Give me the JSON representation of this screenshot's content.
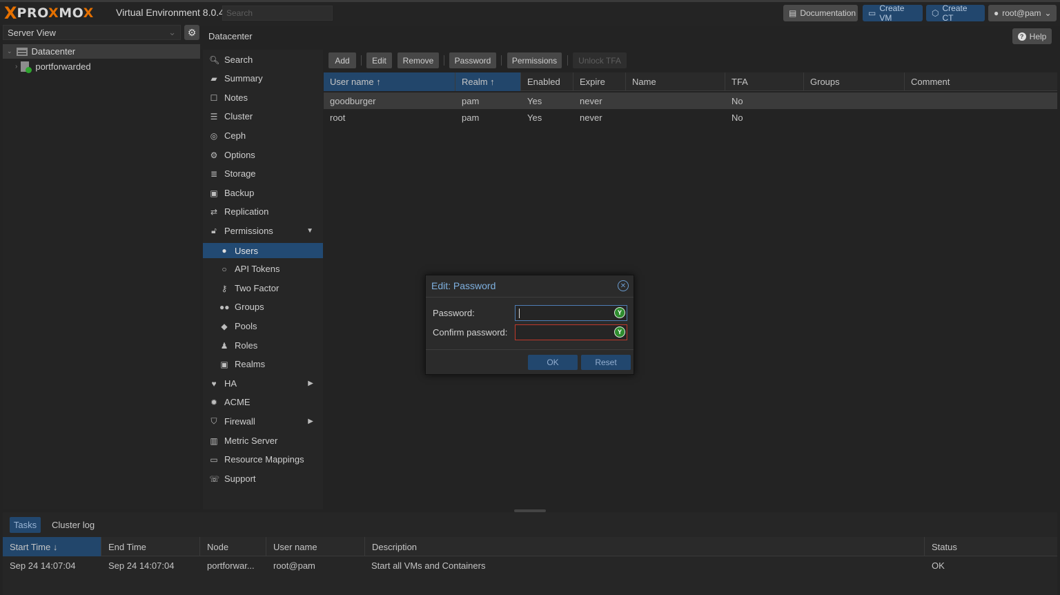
{
  "topbar": {
    "logo_x": "X",
    "logo_word_a": "PRO",
    "logo_word_o": "X",
    "logo_word_b": "MO",
    "logo_word_x": "X",
    "version": "Virtual Environment 8.0.4",
    "search_placeholder": "Search",
    "documentation": "Documentation",
    "create_vm": "Create VM",
    "create_ct": "Create CT",
    "user": "root@pam"
  },
  "tree": {
    "view_label": "Server View",
    "datacenter": "Datacenter",
    "node": "portforwarded"
  },
  "header": {
    "title": "Datacenter",
    "help": "Help"
  },
  "nav": {
    "search": "Search",
    "summary": "Summary",
    "notes": "Notes",
    "cluster": "Cluster",
    "ceph": "Ceph",
    "options": "Options",
    "storage": "Storage",
    "backup": "Backup",
    "replication": "Replication",
    "permissions": "Permissions",
    "users": "Users",
    "api_tokens": "API Tokens",
    "two_factor": "Two Factor",
    "groups": "Groups",
    "pools": "Pools",
    "roles": "Roles",
    "realms": "Realms",
    "ha": "HA",
    "acme": "ACME",
    "firewall": "Firewall",
    "metric_server": "Metric Server",
    "resource_mappings": "Resource Mappings",
    "support": "Support"
  },
  "toolbar": {
    "add": "Add",
    "edit": "Edit",
    "remove": "Remove",
    "password": "Password",
    "permissions": "Permissions",
    "unlock_tfa": "Unlock TFA"
  },
  "grid": {
    "columns": {
      "username": "User name ↑",
      "realm": "Realm ↑",
      "enabled": "Enabled",
      "expire": "Expire",
      "name": "Name",
      "tfa": "TFA",
      "groups": "Groups",
      "comment": "Comment"
    },
    "rows": [
      {
        "username": "goodburger",
        "realm": "pam",
        "enabled": "Yes",
        "expire": "never",
        "name": "",
        "tfa": "No",
        "groups": "",
        "comment": ""
      },
      {
        "username": "root",
        "realm": "pam",
        "enabled": "Yes",
        "expire": "never",
        "name": "",
        "tfa": "No",
        "groups": "",
        "comment": ""
      }
    ]
  },
  "modal": {
    "title": "Edit: Password",
    "password_label": "Password:",
    "password_value": "",
    "confirm_label": "Confirm password:",
    "confirm_value": "",
    "ok": "OK",
    "reset": "Reset"
  },
  "tasks": {
    "tab_tasks": "Tasks",
    "tab_cluster_log": "Cluster log",
    "columns": {
      "start": "Start Time ↓",
      "end": "End Time",
      "node": "Node",
      "user": "User name",
      "description": "Description",
      "status": "Status"
    },
    "rows": [
      {
        "start": "Sep 24 14:07:04",
        "end": "Sep 24 14:07:04",
        "node": "portforwar...",
        "user": "root@pam",
        "description": "Start all VMs and Containers",
        "status": "OK"
      }
    ]
  },
  "colors": {
    "accent": "#224a73",
    "logo_orange": "#e57000",
    "background": "#232323",
    "error": "#c0392b",
    "ok_green": "#2e8c2e"
  }
}
